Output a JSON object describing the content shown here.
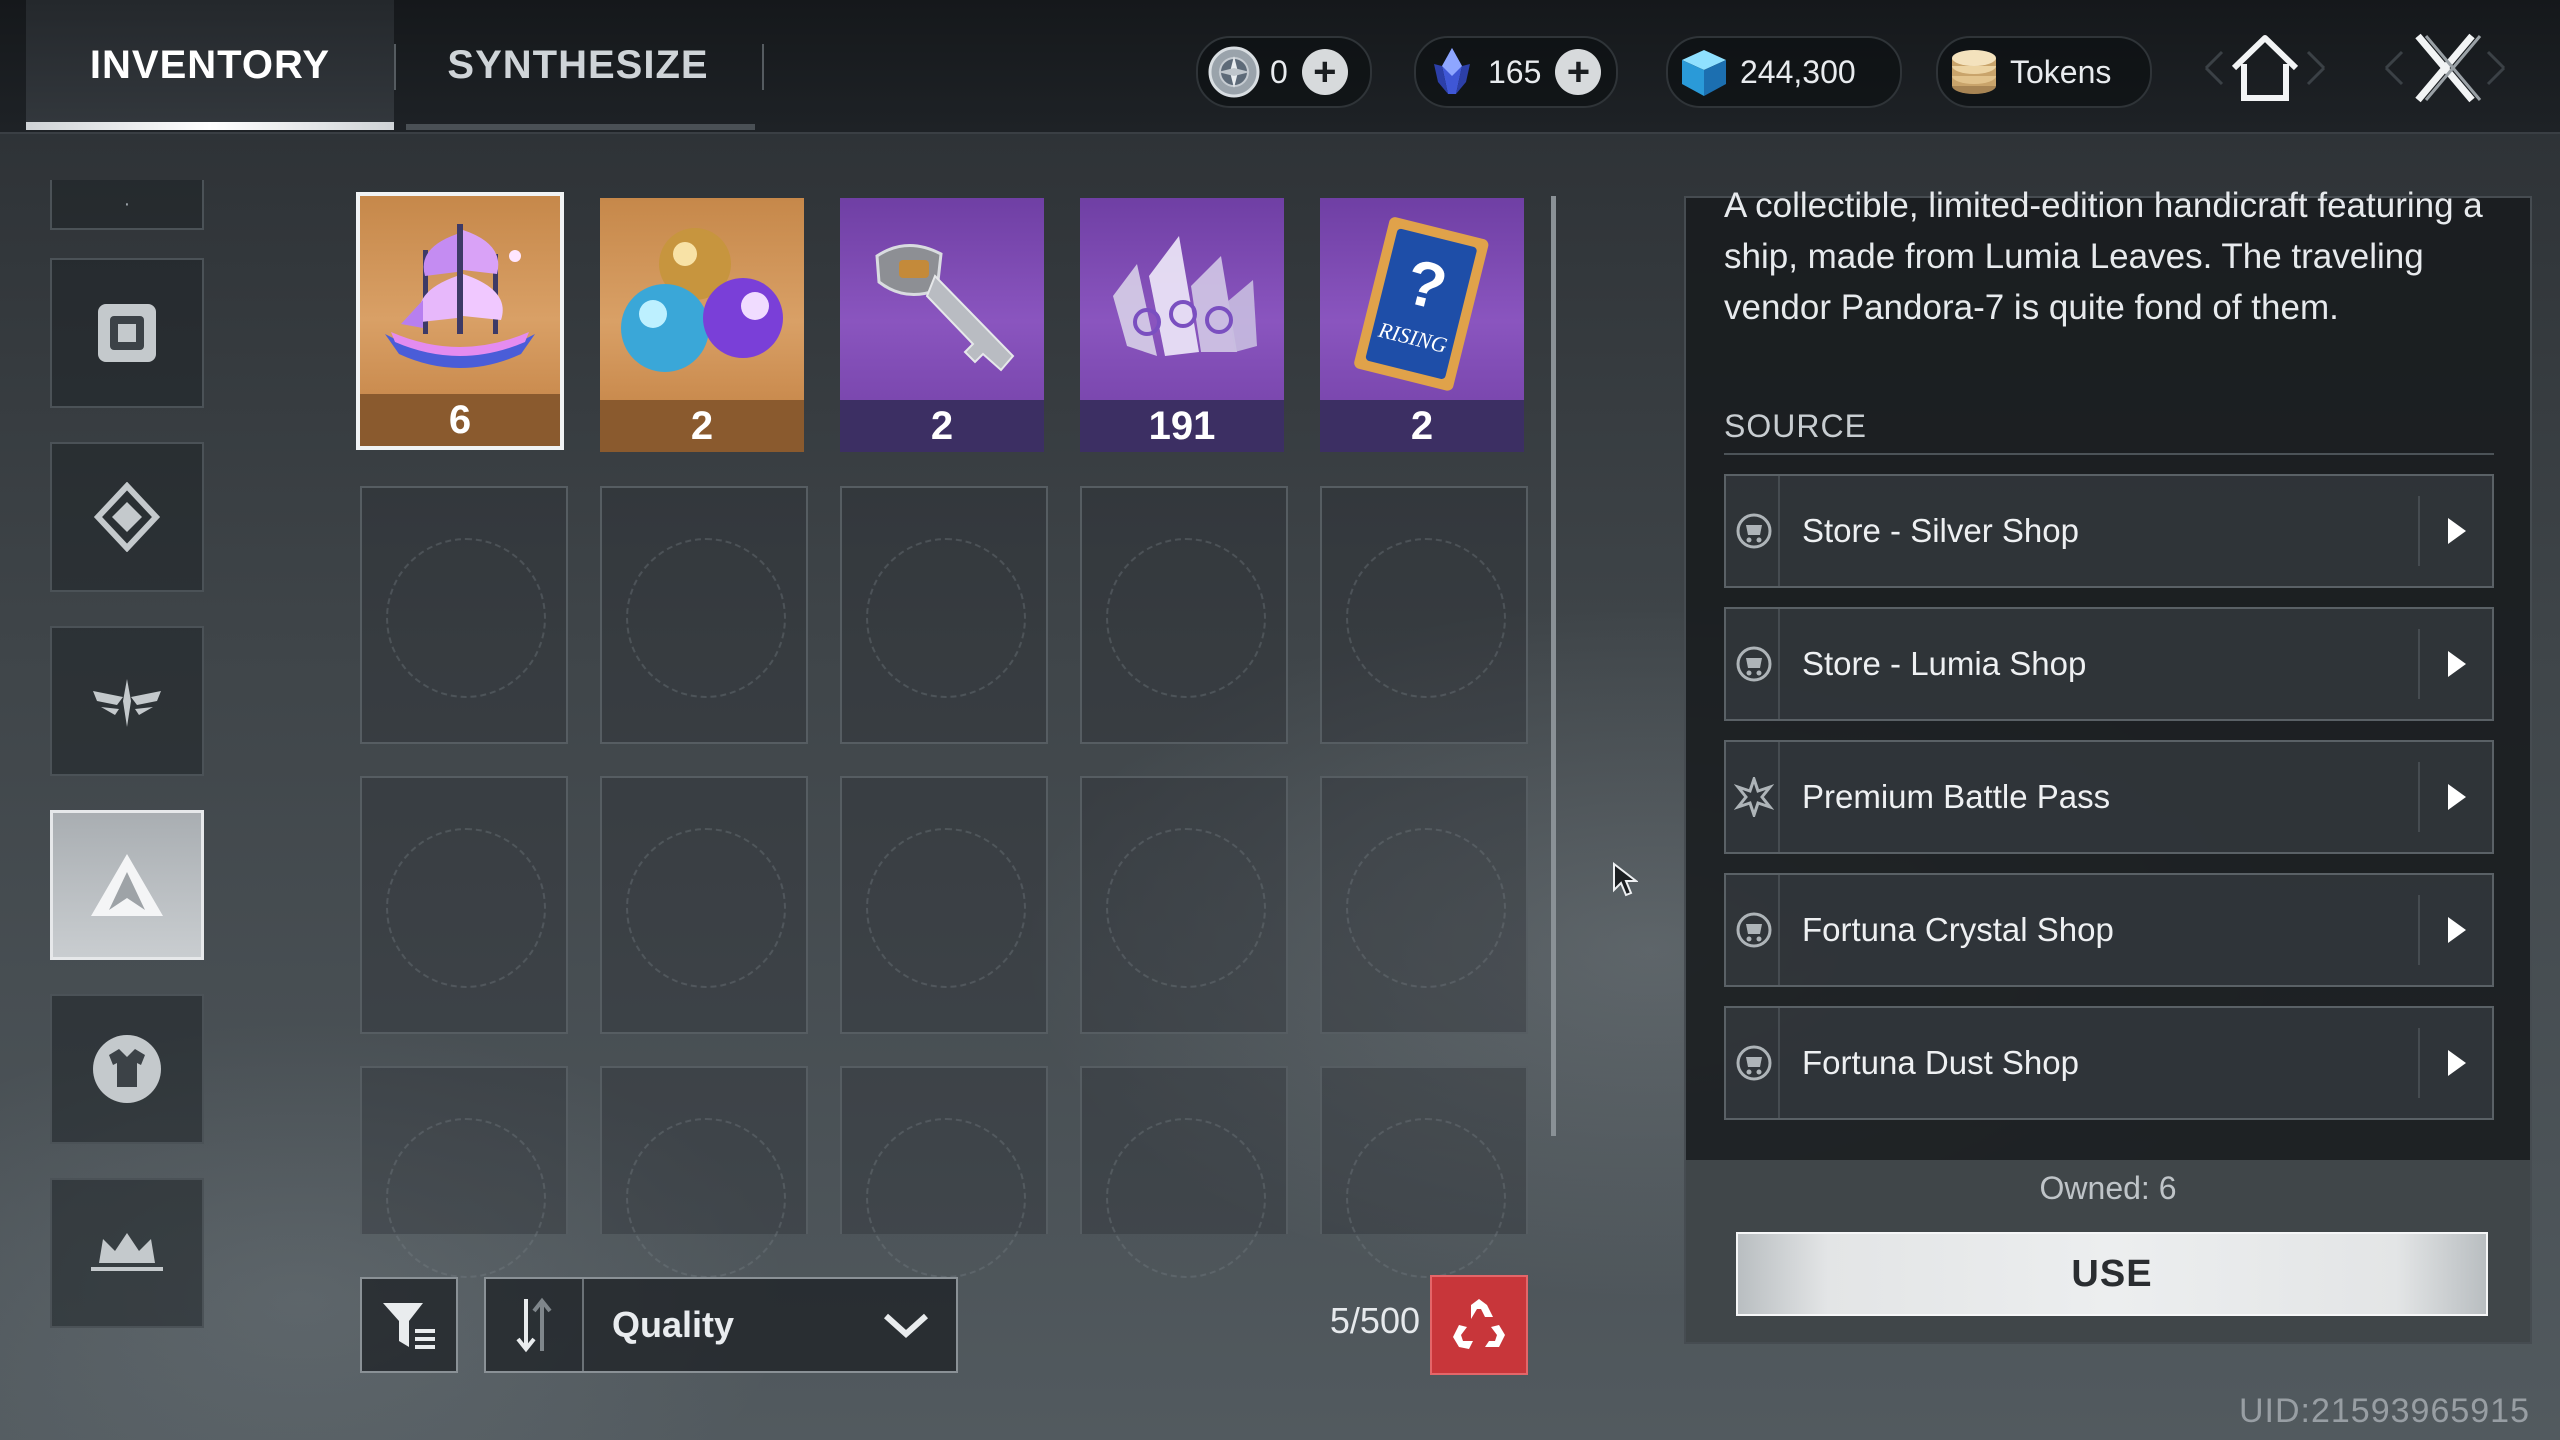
{
  "tabs": [
    {
      "label": "INVENTORY",
      "active": true
    },
    {
      "label": "SYNTHESIZE",
      "active": false
    }
  ],
  "currencies": [
    {
      "name": "compass-coin",
      "value": "0",
      "has_plus": true
    },
    {
      "name": "crystal",
      "value": "165",
      "has_plus": true
    },
    {
      "name": "cube-gem",
      "value": "244,300",
      "has_plus": false
    },
    {
      "name": "tokens",
      "value": "Tokens",
      "has_plus": false
    }
  ],
  "nav": {
    "home_icon": "home-icon",
    "close_icon": "close-icon"
  },
  "categories": [
    {
      "icon": "category-partial-icon",
      "active": false
    },
    {
      "icon": "chip-icon",
      "active": false
    },
    {
      "icon": "diamond-emblem-icon",
      "active": false
    },
    {
      "icon": "winged-emblem-icon",
      "active": false
    },
    {
      "icon": "triangle-emblem-icon",
      "active": true
    },
    {
      "icon": "shirt-icon",
      "active": false
    },
    {
      "icon": "crown-icon",
      "active": false
    }
  ],
  "items": [
    {
      "name": "lumia-leaf-ship",
      "count": "6",
      "quality": "gold",
      "selected": true
    },
    {
      "name": "orbs",
      "count": "2",
      "quality": "gold",
      "selected": false
    },
    {
      "name": "key",
      "count": "2",
      "quality": "purple",
      "selected": false
    },
    {
      "name": "crystal-shards",
      "count": "191",
      "quality": "purple",
      "selected": false
    },
    {
      "name": "mystery-pack",
      "count": "2",
      "quality": "purple",
      "selected": false
    }
  ],
  "item_art_text": {
    "mystery_pack_mark": "?",
    "mystery_pack_caption": "RISING"
  },
  "controls": {
    "sort_label": "Quality",
    "capacity": "5/500"
  },
  "detail": {
    "description": "A collectible, limited-edition handicraft featuring a ship, made from Lumia Leaves. The traveling vendor Pandora-7 is quite fond of them.",
    "source_title": "SOURCE",
    "sources": [
      {
        "label": "Store - Silver Shop",
        "icon": "store-icon"
      },
      {
        "label": "Store - Lumia Shop",
        "icon": "store-icon"
      },
      {
        "label": "Premium Battle Pass",
        "icon": "battle-pass-icon"
      },
      {
        "label": "Fortuna Crystal Shop",
        "icon": "store-icon"
      },
      {
        "label": "Fortuna Dust Shop",
        "icon": "store-icon"
      }
    ],
    "owned": "Owned: 6",
    "use_label": "USE"
  },
  "uid": "UID:21593965915",
  "colors": {
    "gold_bg": "#d9a066",
    "purple_bg": "#8a55bf",
    "recycle_red": "#c8363a"
  }
}
